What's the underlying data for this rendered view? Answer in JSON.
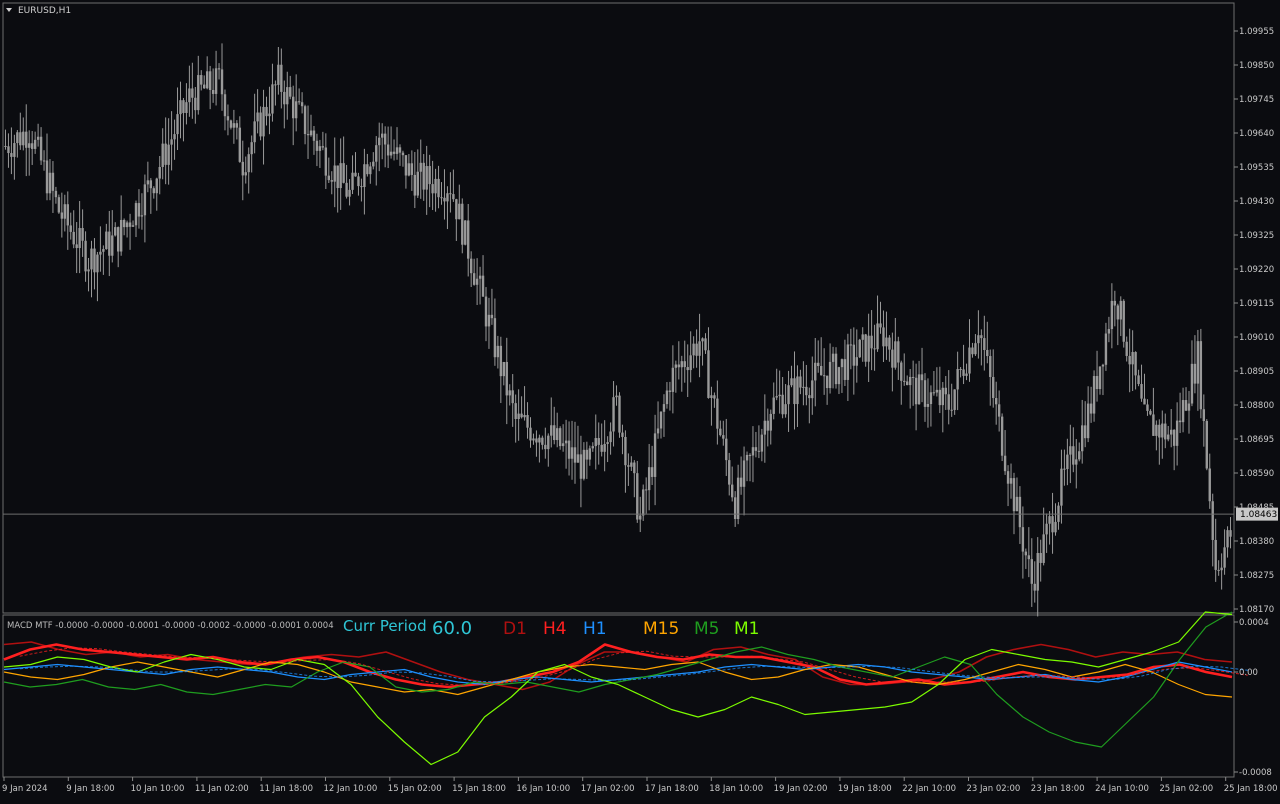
{
  "window": {
    "symbol_label": "EURUSD,H1",
    "current_price": "1.08463"
  },
  "price_axis": {
    "ticks": [
      "1.09955",
      "1.09850",
      "1.09745",
      "1.09640",
      "1.09535",
      "1.09430",
      "1.09325",
      "1.09220",
      "1.09115",
      "1.09010",
      "1.08905",
      "1.08800",
      "1.08695",
      "1.08590",
      "1.08485",
      "1.08380",
      "1.08275",
      "1.08170"
    ]
  },
  "time_axis": {
    "ticks": [
      "9 Jan 2024",
      "9 Jan 18:00",
      "10 Jan 10:00",
      "11 Jan 02:00",
      "11 Jan 18:00",
      "12 Jan 10:00",
      "15 Jan 02:00",
      "15 Jan 18:00",
      "16 Jan 10:00",
      "17 Jan 02:00",
      "17 Jan 18:00",
      "18 Jan 10:00",
      "19 Jan 02:00",
      "19 Jan 18:00",
      "22 Jan 10:00",
      "23 Jan 02:00",
      "23 Jan 18:00",
      "24 Jan 10:00",
      "25 Jan 02:00",
      "25 Jan 18:00"
    ]
  },
  "indicator": {
    "title": "MACD MTF -0.0000 -0.0000 -0.0001 -0.0000 -0.0002 -0.0000 -0.0001 0.0004",
    "curr_period_label": "Curr Period",
    "curr_period_value": "60.0",
    "timeframes": [
      {
        "label": "D1",
        "color": "#b01010"
      },
      {
        "label": "H4",
        "color": "#ff2020"
      },
      {
        "label": "H1",
        "color": "#1e90ff"
      },
      {
        "label": "M15",
        "color": "#ffa500"
      },
      {
        "label": "M5",
        "color": "#1f9d1f"
      },
      {
        "label": "M1",
        "color": "#7cfc00"
      }
    ],
    "axis_ticks": [
      "0.0004",
      "0.00",
      "-0.0008"
    ]
  },
  "chart_data": [
    {
      "type": "candlestick",
      "title": "EURUSD,H1",
      "ylim": [
        1.0812,
        1.1005
      ],
      "current_price": 1.08463,
      "x_range": [
        "9 Jan 2024",
        "25 Jan 18:00"
      ],
      "anchors": [
        {
          "t": 0,
          "p": 1.096
        },
        {
          "t": 8,
          "p": 1.0965
        },
        {
          "t": 18,
          "p": 1.094
        },
        {
          "t": 28,
          "p": 1.0925
        },
        {
          "t": 38,
          "p": 1.0932
        },
        {
          "t": 50,
          "p": 1.095
        },
        {
          "t": 62,
          "p": 1.0975
        },
        {
          "t": 72,
          "p": 1.098
        },
        {
          "t": 80,
          "p": 1.0955
        },
        {
          "t": 92,
          "p": 1.098
        },
        {
          "t": 104,
          "p": 1.0962
        },
        {
          "t": 116,
          "p": 1.0945
        },
        {
          "t": 126,
          "p": 1.0963
        },
        {
          "t": 138,
          "p": 1.095
        },
        {
          "t": 150,
          "p": 1.0948
        },
        {
          "t": 160,
          "p": 1.0915
        },
        {
          "t": 172,
          "p": 1.0875
        },
        {
          "t": 184,
          "p": 1.087
        },
        {
          "t": 196,
          "p": 1.086
        },
        {
          "t": 206,
          "p": 1.088
        },
        {
          "t": 214,
          "p": 1.0845
        },
        {
          "t": 224,
          "p": 1.0888
        },
        {
          "t": 234,
          "p": 1.09
        },
        {
          "t": 246,
          "p": 1.085
        },
        {
          "t": 258,
          "p": 1.088
        },
        {
          "t": 270,
          "p": 1.0887
        },
        {
          "t": 282,
          "p": 1.0892
        },
        {
          "t": 296,
          "p": 1.0902
        },
        {
          "t": 306,
          "p": 1.0885
        },
        {
          "t": 318,
          "p": 1.088
        },
        {
          "t": 328,
          "p": 1.0905
        },
        {
          "t": 338,
          "p": 1.086
        },
        {
          "t": 346,
          "p": 1.0825
        },
        {
          "t": 356,
          "p": 1.0855
        },
        {
          "t": 366,
          "p": 1.088
        },
        {
          "t": 374,
          "p": 1.0915
        },
        {
          "t": 384,
          "p": 1.0875
        },
        {
          "t": 394,
          "p": 1.087
        },
        {
          "t": 402,
          "p": 1.0895
        },
        {
          "t": 408,
          "p": 1.083
        },
        {
          "t": 413,
          "p": 1.084
        }
      ]
    },
    {
      "type": "line",
      "title": "MACD MTF",
      "ylim": [
        -0.0008,
        0.0004
      ],
      "series": [
        {
          "name": "D1",
          "color": "#b01010",
          "width": 1.6,
          "values": [
            0.00022,
            0.00024,
            0.00018,
            0.00014,
            0.00016,
            0.00012,
            0.00014,
            0.0001,
            8e-05,
            6e-05,
            8e-05,
            0.00012,
            0.00014,
            0.00012,
            0.00016,
            8e-05,
            0.0,
            -6e-05,
            -0.0001,
            -0.00014,
            -8e-05,
            6e-05,
            0.00016,
            0.00016,
            0.00012,
            8e-05,
            0.00018,
            0.0002,
            0.00014,
            0.0001,
            -4e-05,
            -0.0001,
            -0.0001,
            -8e-05,
            -6e-05,
            0.0,
            0.00012,
            0.00018,
            0.00022,
            0.00018,
            0.00012,
            0.00016,
            0.00014,
            0.00016,
            0.0001,
            8e-05
          ]
        },
        {
          "name": "H4",
          "color": "#ff2020",
          "width": 2.6,
          "values": [
            0.0001,
            0.00018,
            0.00022,
            0.00018,
            0.00016,
            0.00014,
            0.00012,
            0.0001,
            0.00012,
            8e-05,
            6e-05,
            0.0001,
            0.00012,
            8e-05,
            0.0,
            -6e-05,
            -0.0001,
            -0.00012,
            -0.0001,
            -8e-05,
            -4e-05,
            0.0,
            8e-05,
            0.00022,
            0.00016,
            0.00012,
            0.0001,
            0.00014,
            0.00012,
            0.00012,
            8e-05,
            4e-05,
            -6e-05,
            -0.0001,
            -8e-05,
            -6e-05,
            -0.0001,
            -8e-05,
            -4e-05,
            0.0,
            -4e-05,
            -6e-05,
            -4e-05,
            -2e-05,
            4e-05,
            6e-05,
            0.0,
            -4e-05
          ]
        },
        {
          "name": "H1",
          "color": "#1e90ff",
          "width": 1.2,
          "values": [
            2e-05,
            4e-05,
            6e-05,
            4e-05,
            2e-05,
            0.0,
            -2e-05,
            2e-05,
            4e-05,
            2e-05,
            0.0,
            -4e-05,
            -6e-05,
            -2e-05,
            0.0,
            2e-05,
            -4e-05,
            -8e-05,
            -0.0001,
            -6e-05,
            -4e-05,
            -6e-05,
            -8e-05,
            -6e-05,
            -4e-05,
            -2e-05,
            0.0,
            4e-05,
            6e-05,
            4e-05,
            2e-05,
            4e-05,
            6e-05,
            4e-05,
            0.0,
            -2e-05,
            -4e-05,
            -6e-05,
            -4e-05,
            -2e-05,
            -6e-05,
            -8e-05,
            -4e-05,
            2e-05,
            8e-05,
            4e-05,
            0.0
          ]
        },
        {
          "name": "M15",
          "color": "#ffa500",
          "width": 1.2,
          "values": [
            0.0,
            -4e-05,
            -6e-05,
            -2e-05,
            4e-05,
            8e-05,
            4e-05,
            0.0,
            -4e-05,
            2e-05,
            8e-05,
            6e-05,
            0.0,
            -8e-05,
            -0.00012,
            -0.00016,
            -0.00014,
            -0.00018,
            -0.00012,
            -6e-05,
            0.0,
            4e-05,
            6e-05,
            4e-05,
            2e-05,
            6e-05,
            8e-05,
            0.0,
            -6e-05,
            -4e-05,
            2e-05,
            6e-05,
            4e-05,
            -2e-05,
            -8e-05,
            -0.0001,
            -6e-05,
            0.0,
            6e-05,
            2e-05,
            -4e-05,
            0.0,
            6e-05,
            0.0,
            -0.0001,
            -0.00018,
            -0.0002
          ]
        },
        {
          "name": "M5",
          "color": "#1f9d1f",
          "width": 1.2,
          "values": [
            -8e-05,
            -0.00012,
            -0.0001,
            -6e-05,
            -0.00012,
            -0.00014,
            -0.0001,
            -0.00016,
            -0.00018,
            -0.00014,
            -0.0001,
            -0.00012,
            0.0,
            8e-05,
            4e-05,
            -0.00012,
            -0.00016,
            -0.00014,
            -8e-05,
            -0.0001,
            -8e-05,
            -0.00012,
            -0.00016,
            -0.0001,
            -6e-05,
            -2e-05,
            4e-05,
            0.0001,
            0.00016,
            0.0002,
            0.00014,
            0.0001,
            4e-05,
            0.0,
            -4e-05,
            4e-05,
            0.00012,
            6e-05,
            -0.00018,
            -0.00036,
            -0.00048,
            -0.00056,
            -0.0006,
            -0.0004,
            -0.0002,
            0.0001,
            0.00036,
            0.00048
          ]
        },
        {
          "name": "M1",
          "color": "#7cfc00",
          "width": 1.2,
          "values": [
            4e-05,
            6e-05,
            0.00012,
            0.0001,
            4e-05,
            0.0,
            8e-05,
            0.00014,
            0.0001,
            4e-05,
            2e-05,
            0.0001,
            6e-05,
            -0.0001,
            -0.00036,
            -0.00056,
            -0.00074,
            -0.00064,
            -0.00036,
            -0.0002,
            0.0,
            6e-05,
            -4e-05,
            -0.0001,
            -0.0002,
            -0.0003,
            -0.00036,
            -0.0003,
            -0.0002,
            -0.00026,
            -0.00034,
            -0.00032,
            -0.0003,
            -0.00028,
            -0.00024,
            -0.0001,
            0.0001,
            0.00018,
            0.00014,
            0.0001,
            8e-05,
            4e-05,
            0.0001,
            0.00016,
            0.00024,
            0.00048,
            0.00046
          ]
        }
      ]
    }
  ]
}
